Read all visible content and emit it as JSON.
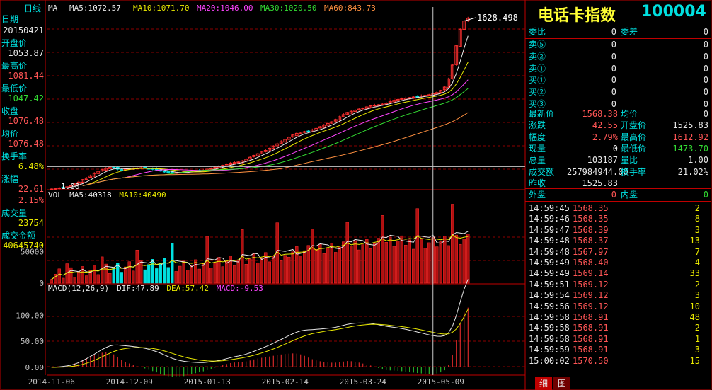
{
  "toolbar": {
    "period": "日线",
    "indicator": "MA"
  },
  "ma_legend": [
    {
      "label": "MA5:1072.57",
      "color": "#e8e8e8"
    },
    {
      "label": "MA10:1071.70",
      "color": "#e8e800"
    },
    {
      "label": "MA20:1046.00",
      "color": "#ff44ff"
    },
    {
      "label": "MA30:1020.50",
      "color": "#33dd33"
    },
    {
      "label": "MA60:843.73",
      "color": "#ff9040"
    }
  ],
  "vol_legend": [
    {
      "label": "VOL",
      "color": "#e8e8e8"
    },
    {
      "label": "MA5:40318",
      "color": "#e8e8e8"
    },
    {
      "label": "MA10:40490",
      "color": "#e8e800"
    }
  ],
  "macd_legend": [
    {
      "label": "MACD(12,26,9)",
      "color": "#e8e8e8"
    },
    {
      "label": "DIF:47.89",
      "color": "#e8e8e8"
    },
    {
      "label": "DEA:57.42",
      "color": "#e8e800"
    },
    {
      "label": "MACD:-9.53",
      "color": "#ff44ff"
    }
  ],
  "price_labels": {
    "high": "1628.498",
    "low": "1.00"
  },
  "info_panel": {
    "date_label": "日期",
    "date": "20150421",
    "open_label": "开盘价",
    "open": "1053.87",
    "high_label": "最高价",
    "high": "1081.44",
    "low_label": "最低价",
    "low": "1047.42",
    "close_label": "收盘",
    "close": "1076.48",
    "avg_label": "均价",
    "avg": "1076.48",
    "turnover_label": "换手率",
    "turnover": "6.48%",
    "change_label": "涨幅",
    "change_abs": "22.61",
    "change_pct": "2.15%",
    "volume_label": "成交量",
    "volume": "23754",
    "amount_label": "成交金额",
    "amount": "40645740"
  },
  "right_panel": {
    "name": "电话卡指数",
    "code": "100004",
    "webi_label": "委比",
    "webi": "0",
    "weicha_label": "委差",
    "weicha": "0",
    "sell": [
      {
        "label": "卖⑤",
        "price": "0",
        "vol": "0"
      },
      {
        "label": "卖②",
        "price": "0",
        "vol": "0"
      },
      {
        "label": "卖①",
        "price": "0",
        "vol": "0"
      }
    ],
    "buy": [
      {
        "label": "买①",
        "price": "0",
        "vol": "0"
      },
      {
        "label": "买②",
        "price": "0",
        "vol": "0"
      },
      {
        "label": "买③",
        "price": "0",
        "vol": "0"
      }
    ],
    "stats": [
      {
        "l1": "最新价",
        "v1": "1568.38",
        "c1": "rd",
        "l2": "均价",
        "v2": "0",
        "c2": "wt"
      },
      {
        "l1": "涨跌",
        "v1": "42.55",
        "c1": "rd",
        "l2": "开盘价",
        "v2": "1525.83",
        "c2": "wt"
      },
      {
        "l1": "幅度",
        "v1": "2.79%",
        "c1": "rd",
        "l2": "最高价",
        "v2": "1612.92",
        "c2": "rd"
      },
      {
        "l1": "现量",
        "v1": "0",
        "c1": "wt",
        "l2": "最低价",
        "v2": "1473.70",
        "c2": "gn"
      },
      {
        "l1": "总量",
        "v1": "103187",
        "c1": "wt",
        "l2": "量比",
        "v2": "1.00",
        "c2": "wt"
      },
      {
        "l1": "成交额",
        "v1": "257984944.00",
        "c1": "wt",
        "l2": "换手率",
        "v2": "21.02%",
        "c2": "wt"
      },
      {
        "l1": "昨收",
        "v1": "1525.83",
        "c1": "wt",
        "l2": "",
        "v2": "",
        "c2": "wt"
      }
    ],
    "outer_label": "外盘",
    "outer": "0",
    "inner_label": "内盘",
    "inner": "0",
    "ticks": [
      {
        "time": "14:59:45",
        "price": "1568.35",
        "vol": "2"
      },
      {
        "time": "14:59:46",
        "price": "1568.35",
        "vol": "8"
      },
      {
        "time": "14:59:47",
        "price": "1568.39",
        "vol": "3"
      },
      {
        "time": "14:59:48",
        "price": "1568.37",
        "vol": "13"
      },
      {
        "time": "14:59:48",
        "price": "1567.97",
        "vol": "7"
      },
      {
        "time": "14:59:49",
        "price": "1568.40",
        "vol": "4"
      },
      {
        "time": "14:59:49",
        "price": "1569.14",
        "vol": "33"
      },
      {
        "time": "14:59:51",
        "price": "1569.12",
        "vol": "2"
      },
      {
        "time": "14:59:54",
        "price": "1569.12",
        "vol": "3"
      },
      {
        "time": "14:59:56",
        "price": "1569.12",
        "vol": "10"
      },
      {
        "time": "14:59:58",
        "price": "1568.91",
        "vol": "48"
      },
      {
        "time": "14:59:58",
        "price": "1568.91",
        "vol": "2"
      },
      {
        "time": "14:59:58",
        "price": "1568.91",
        "vol": "1"
      },
      {
        "time": "14:59:59",
        "price": "1568.91",
        "vol": "3"
      },
      {
        "time": "15:00:02",
        "price": "1570.50",
        "vol": "15"
      }
    ],
    "tabs": [
      "细",
      "图"
    ]
  },
  "chart_data": [
    {
      "type": "candlestick",
      "ylim": [
        1000,
        1640
      ],
      "x_ticks": [
        "2014-11-06",
        "2014-12-09",
        "2015-01-13",
        "2015-02-14",
        "2015-03-24",
        "2015-05-09"
      ],
      "x_tick_index": [
        0,
        20,
        40,
        60,
        80,
        100
      ],
      "cursor_index": 98,
      "crosshair_price": 1081.44,
      "n": 108,
      "closes": [
        1000,
        1002,
        1004,
        1006,
        1008,
        1012,
        1018,
        1025,
        1034,
        1040,
        1048,
        1056,
        1064,
        1070,
        1075,
        1078,
        1076,
        1072,
        1070,
        1072,
        1074,
        1075,
        1076,
        1077,
        1076,
        1074,
        1072,
        1070,
        1066,
        1062,
        1060,
        1058,
        1059,
        1060,
        1062,
        1063,
        1064,
        1065,
        1066,
        1068,
        1072,
        1075,
        1078,
        1082,
        1086,
        1090,
        1094,
        1096,
        1098,
        1102,
        1108,
        1115,
        1122,
        1128,
        1134,
        1140,
        1148,
        1156,
        1164,
        1172,
        1180,
        1188,
        1196,
        1202,
        1206,
        1208,
        1210,
        1214,
        1220,
        1226,
        1232,
        1238,
        1244,
        1252,
        1262,
        1270,
        1278,
        1282,
        1286,
        1290,
        1294,
        1298,
        1302,
        1304,
        1306,
        1308,
        1312,
        1318,
        1322,
        1325,
        1328,
        1330,
        1332,
        1334,
        1336,
        1338,
        1340,
        1342,
        1346,
        1350,
        1358,
        1370,
        1400,
        1450,
        1520,
        1580,
        1610,
        1620
      ]
    },
    {
      "type": "bar",
      "title": "VOL",
      "ylim": [
        0,
        130000
      ],
      "y_ticks": [
        0,
        50000
      ],
      "ma_lines": [
        "MA5",
        "MA10"
      ]
    },
    {
      "type": "line",
      "title": "MACD(12,26,9)",
      "ylim": [
        -15,
        140
      ],
      "y_ticks": [
        "0.00",
        "50.00",
        "100.00"
      ],
      "series": [
        {
          "name": "DIF",
          "color": "#e8e8e8"
        },
        {
          "name": "DEA",
          "color": "#e8e800"
        },
        {
          "name": "MACD",
          "color": "#ff44ff"
        }
      ]
    }
  ]
}
